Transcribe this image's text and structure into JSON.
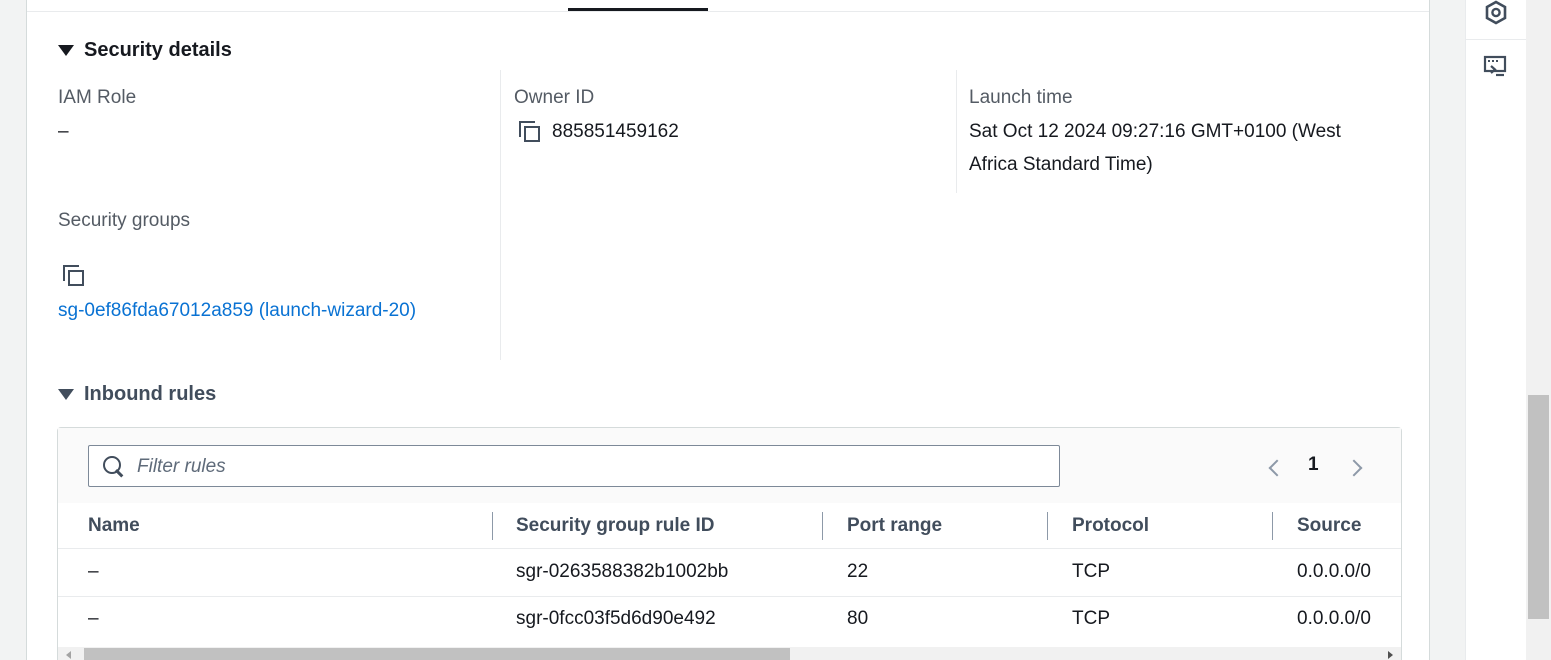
{
  "security_details": {
    "title": "Security details",
    "iam_role_label": "IAM Role",
    "iam_role_value": "–",
    "owner_id_label": "Owner ID",
    "owner_id_value": "885851459162",
    "launch_time_label": "Launch time",
    "launch_time_line1": "Sat Oct 12 2024 09:27:16 GMT+0100 (West",
    "launch_time_line2": "Africa Standard Time)",
    "security_groups_label": "Security groups",
    "security_group_link": "sg-0ef86fda67012a859 (launch-wizard-20)"
  },
  "inbound_rules": {
    "title": "Inbound rules",
    "filter_placeholder": "Filter rules",
    "page": "1",
    "columns": [
      "Name",
      "Security group rule ID",
      "Port range",
      "Protocol",
      "Source"
    ],
    "rows": [
      [
        "–",
        "sgr-0263588382b1002bb",
        "22",
        "TCP",
        "0.0.0.0/0"
      ],
      [
        "–",
        "sgr-0fcc03f5d6d90e492",
        "80",
        "TCP",
        "0.0.0.0/0"
      ]
    ]
  },
  "icons": {
    "copy": "copy-icon",
    "search": "search-icon",
    "rail_top": "hexagon-settings-icon",
    "rail_second": "cloudshell-terminal-icon"
  },
  "colors": {
    "link": "#0972d3",
    "text": "#16191f",
    "label": "#545b64"
  }
}
